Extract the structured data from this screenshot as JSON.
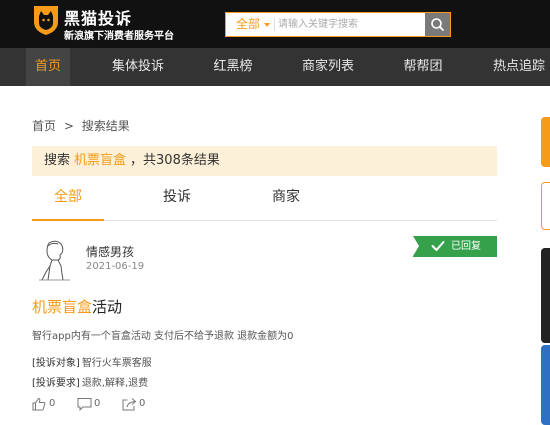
{
  "header": {
    "logo_title": "黑猫投诉",
    "logo_subtitle": "新浪旗下消费者服务平台",
    "search": {
      "category": "全部",
      "placeholder": "请输入关键字搜索"
    }
  },
  "nav": {
    "items": [
      {
        "label": "首页"
      },
      {
        "label": "集体投诉"
      },
      {
        "label": "红黑榜"
      },
      {
        "label": "商家列表"
      },
      {
        "label": "帮帮团"
      },
      {
        "label": "热点追踪"
      }
    ],
    "active_index": 0
  },
  "breadcrumb": {
    "home": "首页",
    "separator": ">",
    "current": "搜索结果"
  },
  "result": {
    "prefix": "搜索",
    "keyword": "机票盲盒",
    "suffix": "，共308条结果"
  },
  "tabs": [
    {
      "label": "全部"
    },
    {
      "label": "投诉"
    },
    {
      "label": "商家"
    }
  ],
  "complaint": {
    "user_name": "情感男孩",
    "date": "2021-06-19",
    "status": "已回复",
    "title_highlight": "机票盲盒",
    "title_rest": "活动",
    "description": "智行app内有一个盲盒活动 支付后不给予退款 退款金额为0",
    "target_label": "[投诉对象]",
    "target_value": "智行火车票客服",
    "demand_label": "[投诉要求]",
    "demand_value": "退款,解释,退费",
    "likes": "0",
    "comments": "0",
    "shares": "0"
  },
  "colors": {
    "accent": "#f59b19",
    "header_bg": "#111111",
    "nav_bg": "#333333",
    "status_green": "#35a24b",
    "result_bg": "#fdf0d8"
  },
  "icons": [
    "cat-shield-logo-icon",
    "search-icon",
    "caret-down-icon",
    "user-avatar-icon",
    "check-icon",
    "thumbs-up-icon",
    "comment-icon",
    "share-icon"
  ]
}
